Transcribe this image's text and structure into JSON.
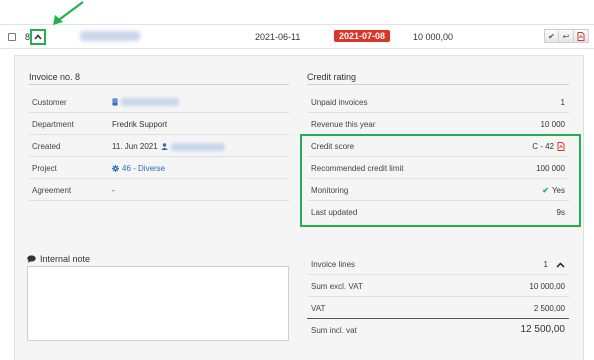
{
  "row": {
    "number": "8",
    "date": "2021-06-11",
    "due_date": "2021-07-08",
    "amount": "10 000,00"
  },
  "invoice_section": {
    "title": "Invoice no. 8",
    "rows": [
      {
        "label": "Customer",
        "value": ""
      },
      {
        "label": "Department",
        "value": "Fredrik Support"
      },
      {
        "label": "Created",
        "value": "11. Jun 2021"
      },
      {
        "label": "Project",
        "value": "46 - Diverse"
      },
      {
        "label": "Agreement",
        "value": "-"
      }
    ]
  },
  "credit_section": {
    "title": "Credit rating",
    "rows": [
      {
        "label": "Unpaid invoices",
        "value": "1"
      },
      {
        "label": "Revenue this year",
        "value": "10 000"
      },
      {
        "label": "Credit score",
        "value": "C - 42"
      },
      {
        "label": "Recommended credit limit",
        "value": "100 000"
      },
      {
        "label": "Monitoring",
        "value": "Yes"
      },
      {
        "label": "Last updated",
        "value": "9s"
      }
    ]
  },
  "note": {
    "title": "Internal note",
    "value": ""
  },
  "totals": {
    "rows": [
      {
        "label": "Invoice lines",
        "value": "1"
      },
      {
        "label": "Sum excl. VAT",
        "value": "10 000,00"
      },
      {
        "label": "VAT",
        "value": "2 500,00"
      },
      {
        "label": "Sum incl. vat",
        "value": "12 500,00"
      }
    ]
  },
  "colors": {
    "highlight": "#22b14c",
    "overdue": "#d9362b",
    "link": "#2a6ebb"
  },
  "icons": [
    "chevron-up-icon",
    "arrow-annotation-icon",
    "check-icon",
    "reply-icon",
    "pdf-icon",
    "building-icon",
    "user-icon",
    "gear-icon",
    "comment-icon"
  ]
}
